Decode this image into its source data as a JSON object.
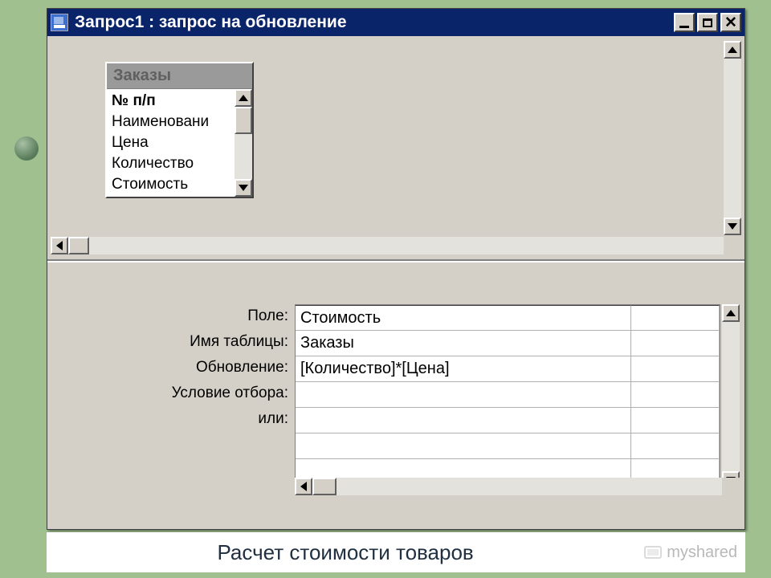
{
  "window": {
    "title": "Запрос1 : запрос на обновление"
  },
  "tablebox": {
    "title": "Заказы",
    "fields": {
      "f0": "№ п/п",
      "f1": "Наименовани",
      "f2": "Цена",
      "f3": "Количество",
      "f4": "Стоимость"
    }
  },
  "grid": {
    "labels": {
      "field": "Поле:",
      "table": "Имя таблицы:",
      "update": "Обновление:",
      "criteria": "Условие отбора:",
      "or": "или:"
    },
    "values": {
      "field": "Стоимость",
      "table": "Заказы",
      "update": "[Количество]*[Цена]",
      "criteria": "",
      "or": ""
    }
  },
  "caption": "Расчет стоимости товаров",
  "watermark": "myshared"
}
